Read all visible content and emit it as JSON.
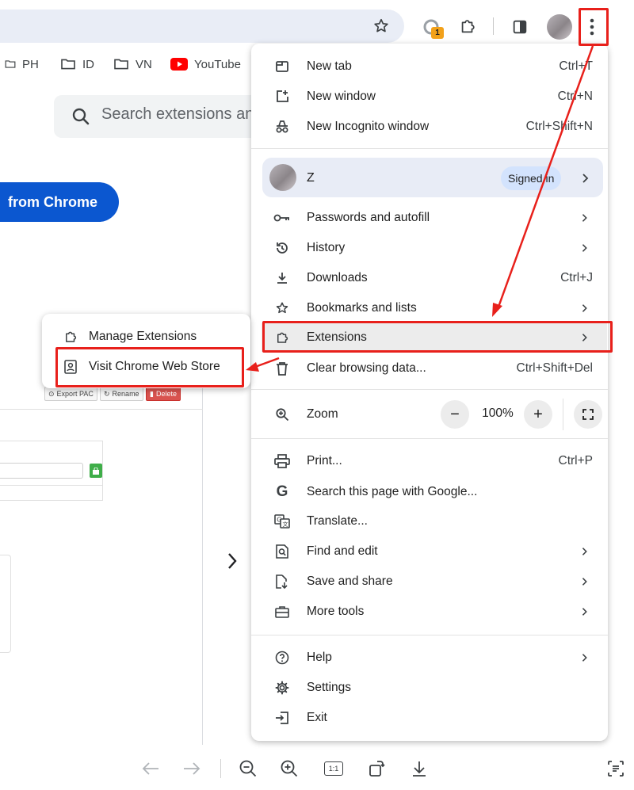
{
  "bookmarks": [
    {
      "label": "PH",
      "icon": "folder-icon"
    },
    {
      "label": "ID",
      "icon": "folder-icon"
    },
    {
      "label": "VN",
      "icon": "folder-icon"
    },
    {
      "label": "YouTube",
      "icon": "youtube-icon"
    }
  ],
  "toolbar": {
    "extension_badge": "1"
  },
  "store": {
    "search_placeholder": "Search extensions and themes",
    "cta_label": "from Chrome"
  },
  "background_panel": {
    "buttons": [
      "Export PAC",
      "Rename",
      "Delete"
    ]
  },
  "menu": {
    "new_tab": {
      "label": "New tab",
      "shortcut": "Ctrl+T"
    },
    "new_window": {
      "label": "New window",
      "shortcut": "Ctrl+N"
    },
    "new_incognito": {
      "label": "New Incognito window",
      "shortcut": "Ctrl+Shift+N"
    },
    "profile": {
      "name": "Z",
      "status": "Signed in"
    },
    "passwords": {
      "label": "Passwords and autofill"
    },
    "history": {
      "label": "History"
    },
    "downloads": {
      "label": "Downloads",
      "shortcut": "Ctrl+J"
    },
    "bookmarks": {
      "label": "Bookmarks and lists"
    },
    "extensions": {
      "label": "Extensions"
    },
    "clear_data": {
      "label": "Clear browsing data...",
      "shortcut": "Ctrl+Shift+Del"
    },
    "zoom": {
      "label": "Zoom",
      "value": "100%",
      "minus": "−",
      "plus": "+"
    },
    "print": {
      "label": "Print...",
      "shortcut": "Ctrl+P"
    },
    "search_page": {
      "label": "Search this page with Google..."
    },
    "translate": {
      "label": "Translate..."
    },
    "find_edit": {
      "label": "Find and edit"
    },
    "save_share": {
      "label": "Save and share"
    },
    "more_tools": {
      "label": "More tools"
    },
    "help": {
      "label": "Help"
    },
    "settings": {
      "label": "Settings"
    },
    "exit": {
      "label": "Exit"
    }
  },
  "submenu": {
    "manage": {
      "label": "Manage Extensions"
    },
    "visit_store": {
      "label": "Visit Chrome Web Store"
    }
  },
  "viewer": {
    "actual_size": "1:1"
  },
  "annotation_color": "#e8201b"
}
